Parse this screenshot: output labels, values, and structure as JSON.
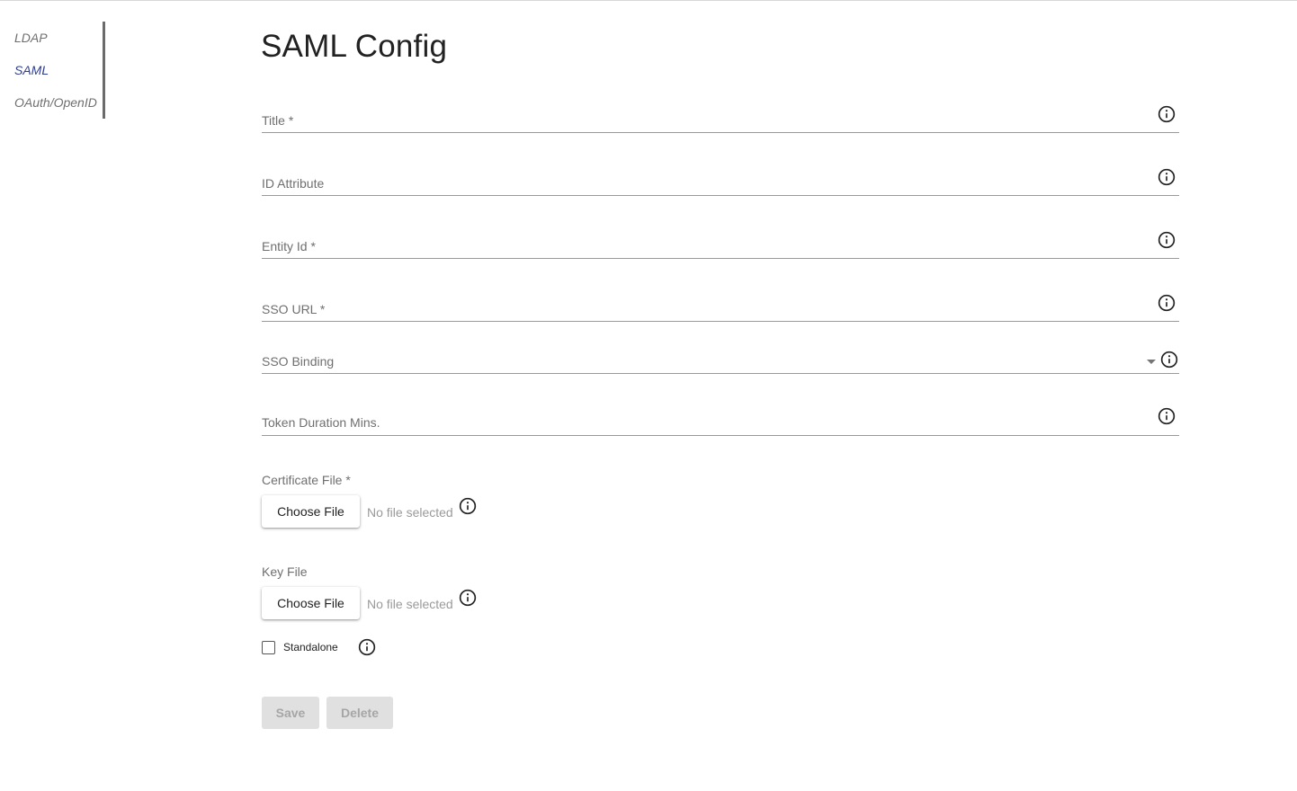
{
  "sidebar": {
    "items": [
      {
        "label": "LDAP",
        "active": false
      },
      {
        "label": "SAML",
        "active": true
      },
      {
        "label": "OAuth/OpenID",
        "active": false
      }
    ],
    "active_color": "#2f3d8f"
  },
  "page": {
    "title": "SAML Config"
  },
  "form": {
    "title_field": {
      "label": "Title *",
      "value": ""
    },
    "id_attribute": {
      "label": "ID Attribute",
      "value": ""
    },
    "entity_id": {
      "label": "Entity Id *",
      "value": ""
    },
    "sso_url": {
      "label": "SSO URL *",
      "value": ""
    },
    "sso_binding": {
      "label": "SSO Binding",
      "value": ""
    },
    "token_duration": {
      "label": "Token Duration Mins.",
      "value": ""
    },
    "certificate_file": {
      "label": "Certificate File *",
      "button": "Choose File",
      "status": "No file selected"
    },
    "key_file": {
      "label": "Key File",
      "button": "Choose File",
      "status": "No file selected"
    },
    "standalone": {
      "label": "Standalone",
      "checked": false
    }
  },
  "actions": {
    "save": "Save",
    "delete": "Delete"
  },
  "icons": {
    "info": "info-circle-icon",
    "dropdown": "caret-down-icon"
  }
}
